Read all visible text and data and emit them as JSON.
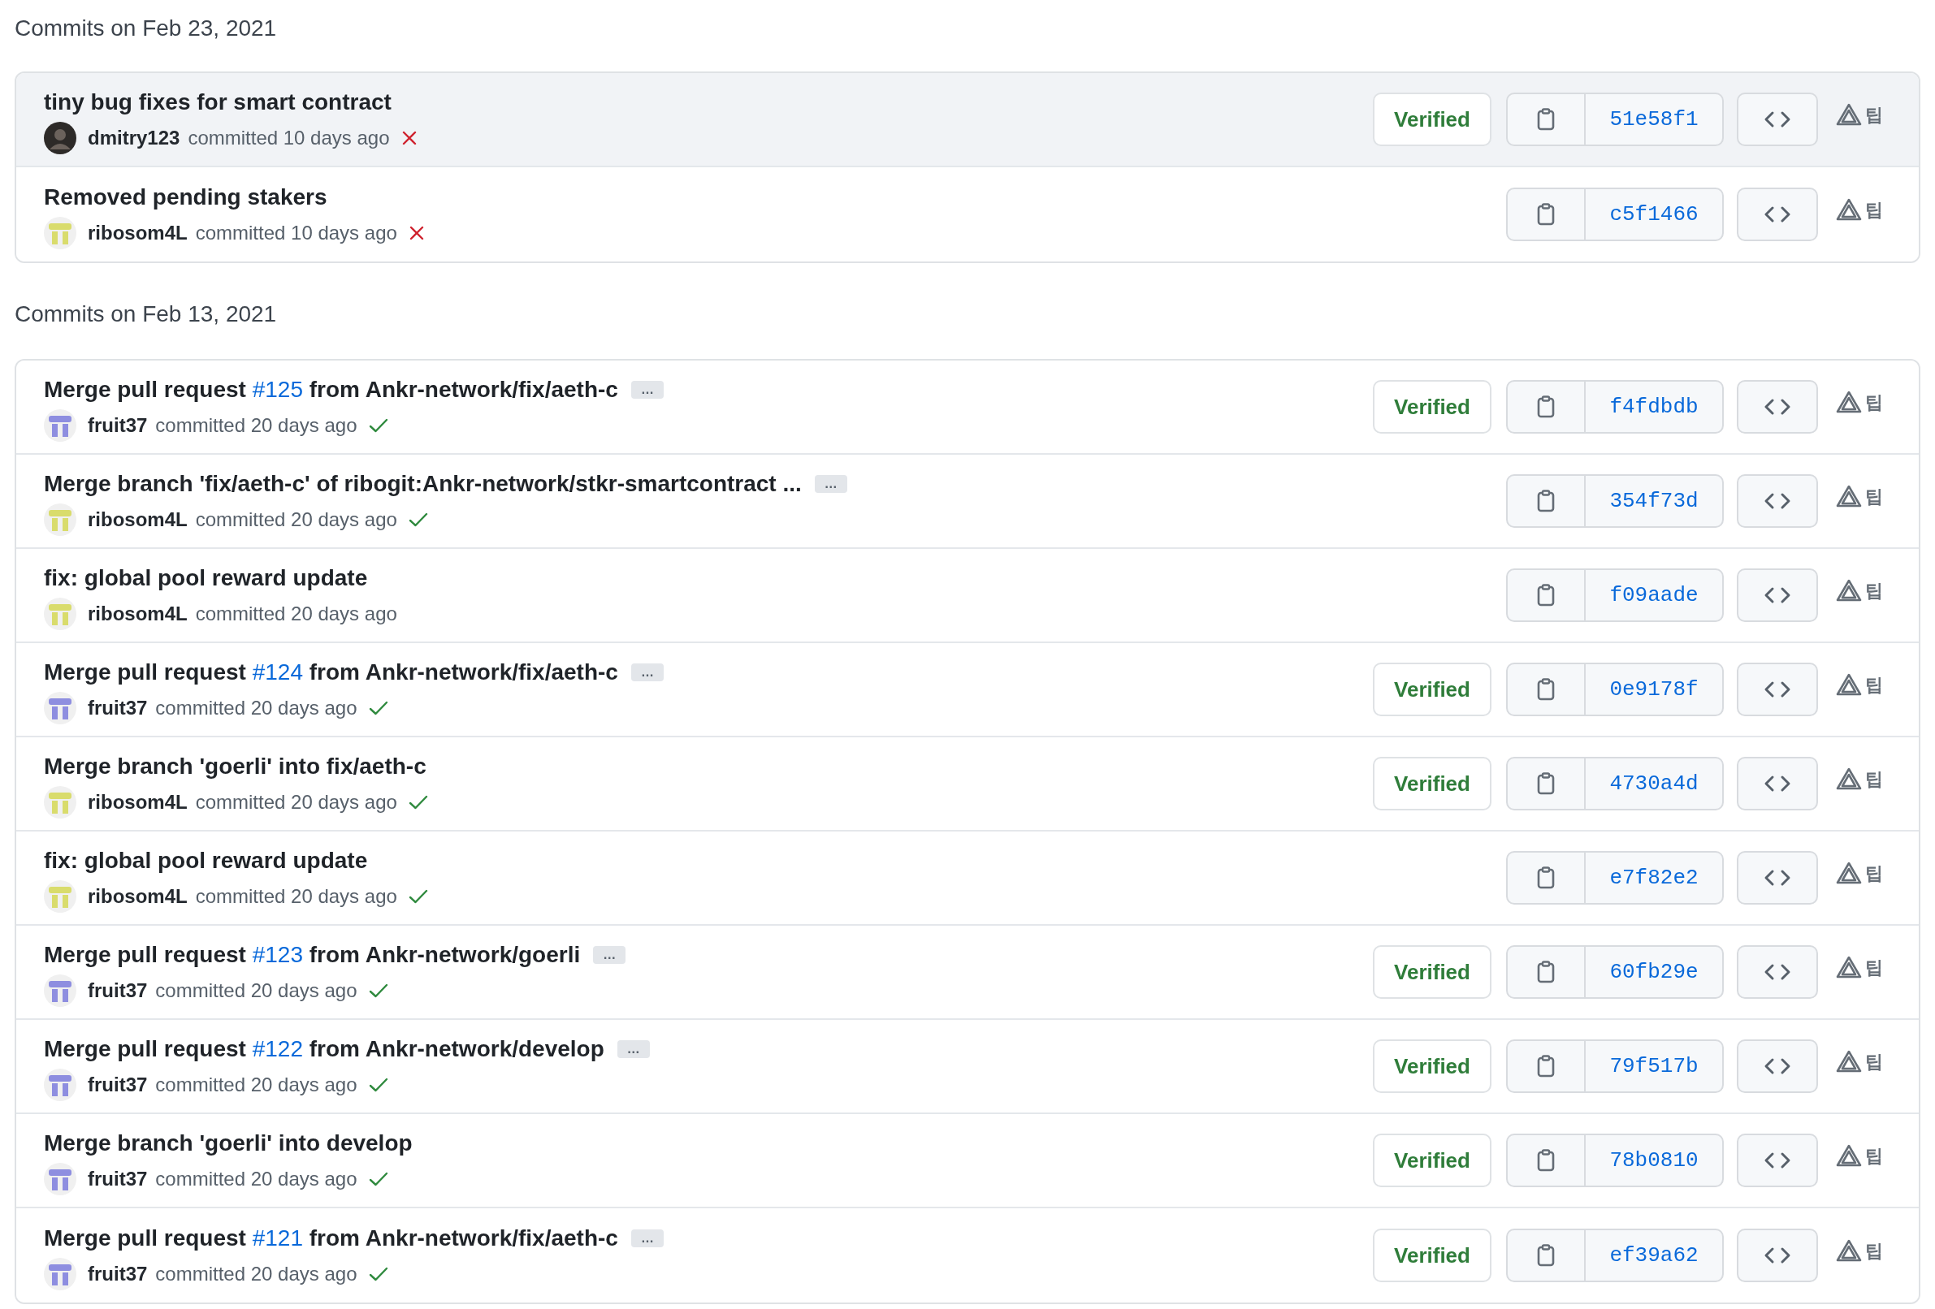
{
  "groups": [
    {
      "heading": "Commits on Feb 23, 2021",
      "commits": [
        {
          "highlighted": true,
          "title": [
            {
              "kind": "text",
              "text": "tiny bug fixes for smart contract"
            }
          ],
          "avatar": {
            "kind": "photo"
          },
          "author": "dmitry123",
          "meta": "committed 10 days ago",
          "status": {
            "kind": "failure"
          },
          "verified": "Verified",
          "sha": "51e58f1",
          "extension_label": "팁"
        },
        {
          "highlighted": false,
          "title": [
            {
              "kind": "text",
              "text": "Removed pending stakers"
            }
          ],
          "avatar": {
            "kind": "identicon",
            "color": "#d9dc6c"
          },
          "author": "ribosom4L",
          "meta": "committed 10 days ago",
          "status": {
            "kind": "failure"
          },
          "sha": "c5f1466",
          "extension_label": "팁"
        }
      ]
    },
    {
      "heading": "Commits on Feb 13, 2021",
      "commits": [
        {
          "highlighted": false,
          "title": [
            {
              "kind": "text",
              "text": "Merge pull request "
            },
            {
              "kind": "link",
              "text": "#125"
            },
            {
              "kind": "text",
              "text": " from Ankr-network/fix/aeth-c"
            }
          ],
          "expand": "…",
          "avatar": {
            "kind": "identicon",
            "color": "#8e8ee0"
          },
          "author": "fruit37",
          "meta": "committed 20 days ago",
          "status": {
            "kind": "success"
          },
          "verified": "Verified",
          "sha": "f4fdbdb",
          "extension_label": "팁"
        },
        {
          "highlighted": false,
          "title": [
            {
              "kind": "text",
              "text": "Merge branch 'fix/aeth-c' of ribogit:Ankr-network/stkr-smartcontract ..."
            }
          ],
          "expand": "…",
          "avatar": {
            "kind": "identicon",
            "color": "#d9dc6c"
          },
          "author": "ribosom4L",
          "meta": "committed 20 days ago",
          "status": {
            "kind": "success"
          },
          "sha": "354f73d",
          "extension_label": "팁"
        },
        {
          "highlighted": false,
          "title": [
            {
              "kind": "text",
              "text": "fix: global pool reward update"
            }
          ],
          "avatar": {
            "kind": "identicon",
            "color": "#d9dc6c"
          },
          "author": "ribosom4L",
          "meta": "committed 20 days ago",
          "sha": "f09aade",
          "extension_label": "팁"
        },
        {
          "highlighted": false,
          "title": [
            {
              "kind": "text",
              "text": "Merge pull request "
            },
            {
              "kind": "link",
              "text": "#124"
            },
            {
              "kind": "text",
              "text": " from Ankr-network/fix/aeth-c"
            }
          ],
          "expand": "…",
          "avatar": {
            "kind": "identicon",
            "color": "#8e8ee0"
          },
          "author": "fruit37",
          "meta": "committed 20 days ago",
          "status": {
            "kind": "success"
          },
          "verified": "Verified",
          "sha": "0e9178f",
          "extension_label": "팁"
        },
        {
          "highlighted": false,
          "title": [
            {
              "kind": "text",
              "text": "Merge branch 'goerli' into fix/aeth-c"
            }
          ],
          "avatar": {
            "kind": "identicon",
            "color": "#d9dc6c"
          },
          "author": "ribosom4L",
          "meta": "committed 20 days ago",
          "status": {
            "kind": "success"
          },
          "verified": "Verified",
          "sha": "4730a4d",
          "extension_label": "팁"
        },
        {
          "highlighted": false,
          "title": [
            {
              "kind": "text",
              "text": "fix: global pool reward update"
            }
          ],
          "avatar": {
            "kind": "identicon",
            "color": "#d9dc6c"
          },
          "author": "ribosom4L",
          "meta": "committed 20 days ago",
          "status": {
            "kind": "success"
          },
          "sha": "e7f82e2",
          "extension_label": "팁"
        },
        {
          "highlighted": false,
          "title": [
            {
              "kind": "text",
              "text": "Merge pull request "
            },
            {
              "kind": "link",
              "text": "#123"
            },
            {
              "kind": "text",
              "text": " from Ankr-network/goerli"
            }
          ],
          "expand": "…",
          "avatar": {
            "kind": "identicon",
            "color": "#8e8ee0"
          },
          "author": "fruit37",
          "meta": "committed 20 days ago",
          "status": {
            "kind": "success"
          },
          "verified": "Verified",
          "sha": "60fb29e",
          "extension_label": "팁"
        },
        {
          "highlighted": false,
          "title": [
            {
              "kind": "text",
              "text": "Merge pull request "
            },
            {
              "kind": "link",
              "text": "#122"
            },
            {
              "kind": "text",
              "text": " from Ankr-network/develop"
            }
          ],
          "expand": "…",
          "avatar": {
            "kind": "identicon",
            "color": "#8e8ee0"
          },
          "author": "fruit37",
          "meta": "committed 20 days ago",
          "status": {
            "kind": "success"
          },
          "verified": "Verified",
          "sha": "79f517b",
          "extension_label": "팁"
        },
        {
          "highlighted": false,
          "title": [
            {
              "kind": "text",
              "text": "Merge branch 'goerli' into develop"
            }
          ],
          "avatar": {
            "kind": "identicon",
            "color": "#8e8ee0"
          },
          "author": "fruit37",
          "meta": "committed 20 days ago",
          "status": {
            "kind": "success"
          },
          "verified": "Verified",
          "sha": "78b0810",
          "extension_label": "팁"
        },
        {
          "highlighted": false,
          "title": [
            {
              "kind": "text",
              "text": "Merge pull request "
            },
            {
              "kind": "link",
              "text": "#121"
            },
            {
              "kind": "text",
              "text": " from Ankr-network/fix/aeth-c"
            }
          ],
          "expand": "…",
          "avatar": {
            "kind": "identicon",
            "color": "#8e8ee0"
          },
          "author": "fruit37",
          "meta": "committed 20 days ago",
          "status": {
            "kind": "success"
          },
          "verified": "Verified",
          "sha": "ef39a62",
          "extension_label": "팁"
        }
      ]
    }
  ]
}
